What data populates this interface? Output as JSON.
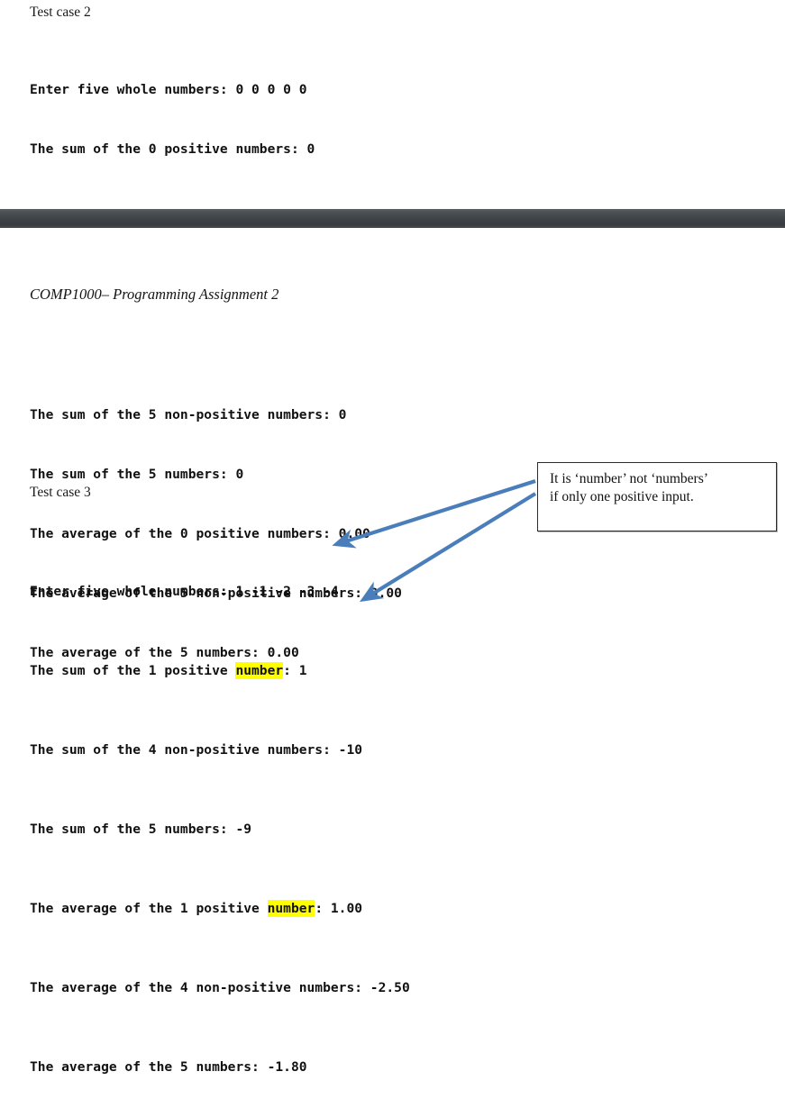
{
  "document": {
    "heading": "COMP1000– Programming Assignment 2"
  },
  "test_case_2": {
    "label": "Test case 2",
    "lines": [
      "Enter five whole numbers: 0 0 0 0 0",
      "The sum of the 0 positive numbers: 0"
    ]
  },
  "test_case_2_continued": {
    "lines": [
      "The sum of the 5 non-positive numbers: 0",
      "The sum of the 5 numbers: 0",
      "The average of the 0 positive numbers: 0.00",
      "The average of the 5 non-positive numbers: 0.00",
      "The average of the 5 numbers: 0.00"
    ]
  },
  "test_case_3": {
    "label": "Test case 3",
    "line_input": "Enter five whole numbers: 1 -1 -2 -3 -4",
    "line_sum_positive_pre": "The sum of the 1 positive ",
    "line_sum_positive_hl": "number",
    "line_sum_positive_post": ": 1",
    "line_sum_nonpositive": "The sum of the 4 non-positive numbers: -10",
    "line_sum_all": "The sum of the 5 numbers: -9",
    "line_avg_positive_pre": "The average of the 1 positive ",
    "line_avg_positive_hl": "number",
    "line_avg_positive_post": ": 1.00",
    "line_avg_nonpositive": "The average of the 4 non-positive numbers: -2.50",
    "line_avg_all": "The average of the 5 numbers: -1.80"
  },
  "annotation": {
    "line1": "It is ‘number’ not ‘numbers’",
    "line2": "if only one positive input."
  },
  "colors": {
    "highlight": "#ffff00",
    "arrow": "#4a7ebb",
    "divider": "#3f4448",
    "callout_border": "#2b2b2b",
    "text": "#111111"
  }
}
